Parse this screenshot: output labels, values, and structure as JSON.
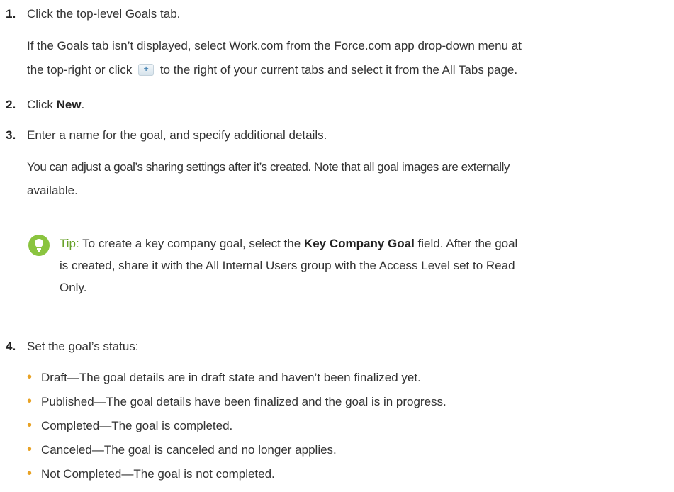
{
  "steps": [
    {
      "number": "1.",
      "text": "Click the top-level Goals tab."
    },
    {
      "number": "2.",
      "prefix": "Click ",
      "bold": "New",
      "suffix": "."
    },
    {
      "number": "3.",
      "text": "Enter a name for the goal, and specify additional details."
    },
    {
      "number": "4.",
      "text": "Set the goal’s status:"
    }
  ],
  "step1_note": {
    "line1": "If the Goals tab isn’t displayed, select Work.com from the Force.com app drop-down menu at",
    "line2_before_icon": "the top-right or click",
    "line2_after_icon": "to the right of your current tabs and select it from the All Tabs page.",
    "icon": "plus-tab-icon"
  },
  "step3_note": {
    "line1": "You can adjust a goal’s sharing settings after it’s created. Note that all goal images are externally",
    "line2": "available."
  },
  "tip": {
    "icon": "lightbulb-icon",
    "label": "Tip:",
    "line1_before": " To create a key company goal, select the ",
    "line1_bold": "Key Company Goal",
    "line1_after": " field. After the goal",
    "line2": "is created, share it with the All Internal Users group with the Access Level set to Read",
    "line3": "Only.",
    "colors": {
      "icon_bg": "#8ac43f",
      "label": "#67a127"
    }
  },
  "statuses": [
    "Draft—The goal details are in draft state and haven’t been finalized yet.",
    "Published—The goal details have been finalized and the goal is in progress.",
    "Completed—The goal is completed.",
    "Canceled—The goal is canceled and no longer applies.",
    "Not Completed—The goal is not completed."
  ],
  "bullet_color": "#e8a224"
}
